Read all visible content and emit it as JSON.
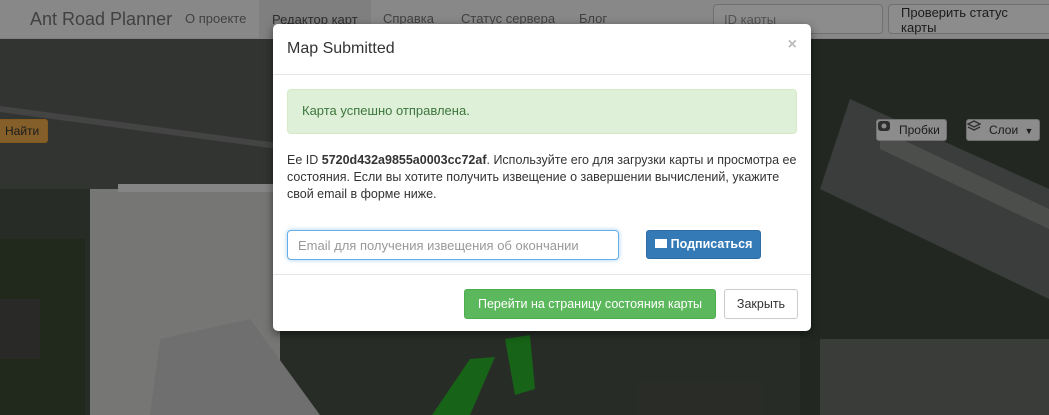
{
  "navbar": {
    "brand": "Ant Road Planner",
    "links": [
      {
        "label": "О проекте",
        "active": false
      },
      {
        "label": "Редактор карт",
        "active": true
      },
      {
        "label": "Справка",
        "active": false
      },
      {
        "label": "Статус сервера",
        "active": false
      },
      {
        "label": "Блог",
        "active": false
      }
    ],
    "search_placeholder": "ID карты",
    "check_button": "Проверить статус карты"
  },
  "map": {
    "find_button": "Найти",
    "controls": [
      {
        "label": "Пробки",
        "icon": "traffic-icon"
      },
      {
        "label": "Слои",
        "icon": "layers-icon"
      }
    ]
  },
  "modal": {
    "title": "Map Submitted",
    "close_symbol": "×",
    "alert": "Карта успешно отправлена.",
    "id_prefix": "Ее ID ",
    "map_id": "5720d432a9855a0003cc72af",
    "id_suffix": ". Используйте его для загрузки карты и просмотра ее состояния. Если вы хотите получить извещение о завершении вычислений, укажите свой email в форме ниже.",
    "email_placeholder": "Email для получения извещения об окончании",
    "subscribe_button": "Подписаться",
    "goto_button": "Перейти на страницу состояния карты",
    "close_button": "Закрыть"
  },
  "colors": {
    "success": "#5cb85c",
    "primary": "#337ab7",
    "warning": "#f0ad4e",
    "alert_bg": "#dff0d8",
    "alert_text": "#3c763d"
  }
}
